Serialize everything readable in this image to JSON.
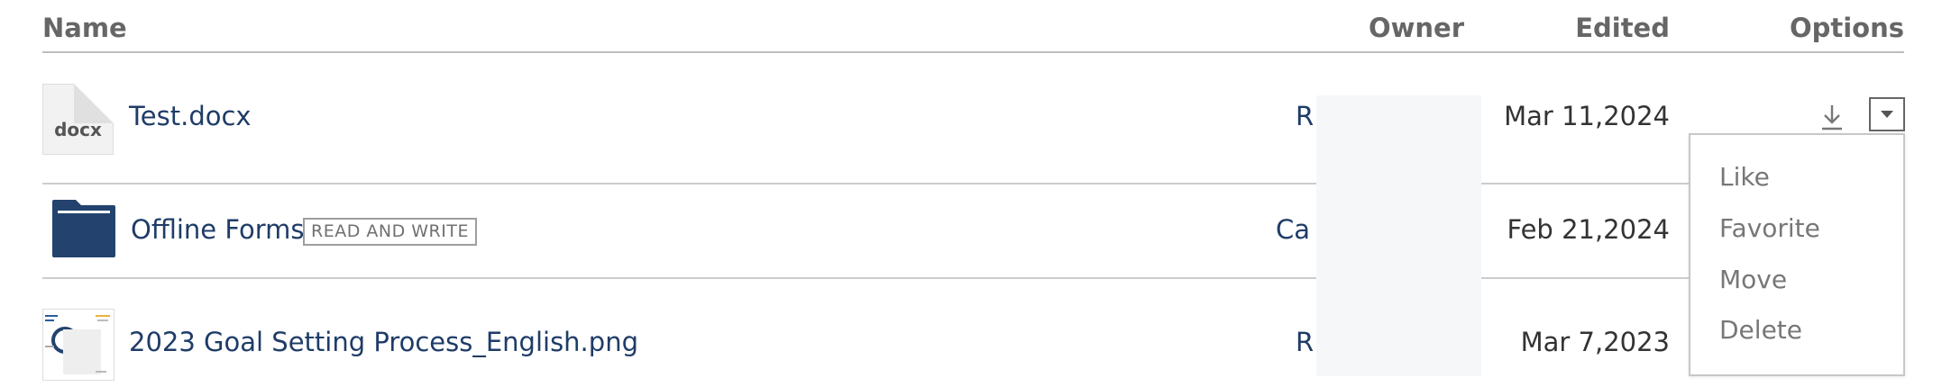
{
  "table": {
    "headers": {
      "name": "Name",
      "owner": "Owner",
      "edited": "Edited",
      "options": "Options"
    },
    "rows": [
      {
        "type": "docx",
        "thumb_label": "docx",
        "name": "Test.docx",
        "badge": "",
        "owner": "R",
        "edited": "Mar 11,2024"
      },
      {
        "type": "folder",
        "name": "Offline Forms",
        "badge": "READ AND WRITE",
        "owner": "Ca",
        "edited": "Feb 21,2024"
      },
      {
        "type": "png",
        "name": "2023 Goal Setting Process_English.png",
        "badge": "",
        "owner": "R",
        "edited": "Mar 7,2023"
      }
    ]
  },
  "options_menu": {
    "items": [
      "Like",
      "Favorite",
      "Move",
      "Delete"
    ]
  },
  "icons": {
    "download": "download-icon",
    "dropdown": "caret-down-icon",
    "folder": "folder-icon",
    "document": "document-icon"
  },
  "colors": {
    "link": "#1f3c68",
    "folder": "#23436e",
    "header_text": "#666666",
    "menu_text": "#777777"
  }
}
